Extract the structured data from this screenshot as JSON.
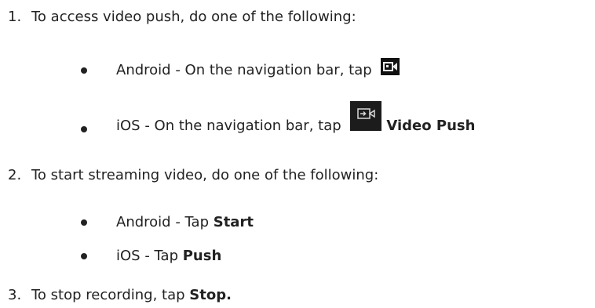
{
  "steps": [
    {
      "number": "1.",
      "text": "To access video push, do one of the following:",
      "bullets": [
        {
          "text": "Android - On the navigation bar, tap ",
          "icon": "video-camera-icon"
        },
        {
          "text": "iOS - On the navigation bar, tap ",
          "icon": "video-push-icon",
          "bold": "Video Push"
        }
      ]
    },
    {
      "number": "2.",
      "text": "To start streaming video, do one of the following:",
      "bullets": [
        {
          "text": "Android - Tap ",
          "bold": "Start"
        },
        {
          "text": "iOS - Tap ",
          "bold": "Push"
        }
      ]
    },
    {
      "number": "3.",
      "text": "To stop recording, tap ",
      "bold": "Stop."
    }
  ]
}
